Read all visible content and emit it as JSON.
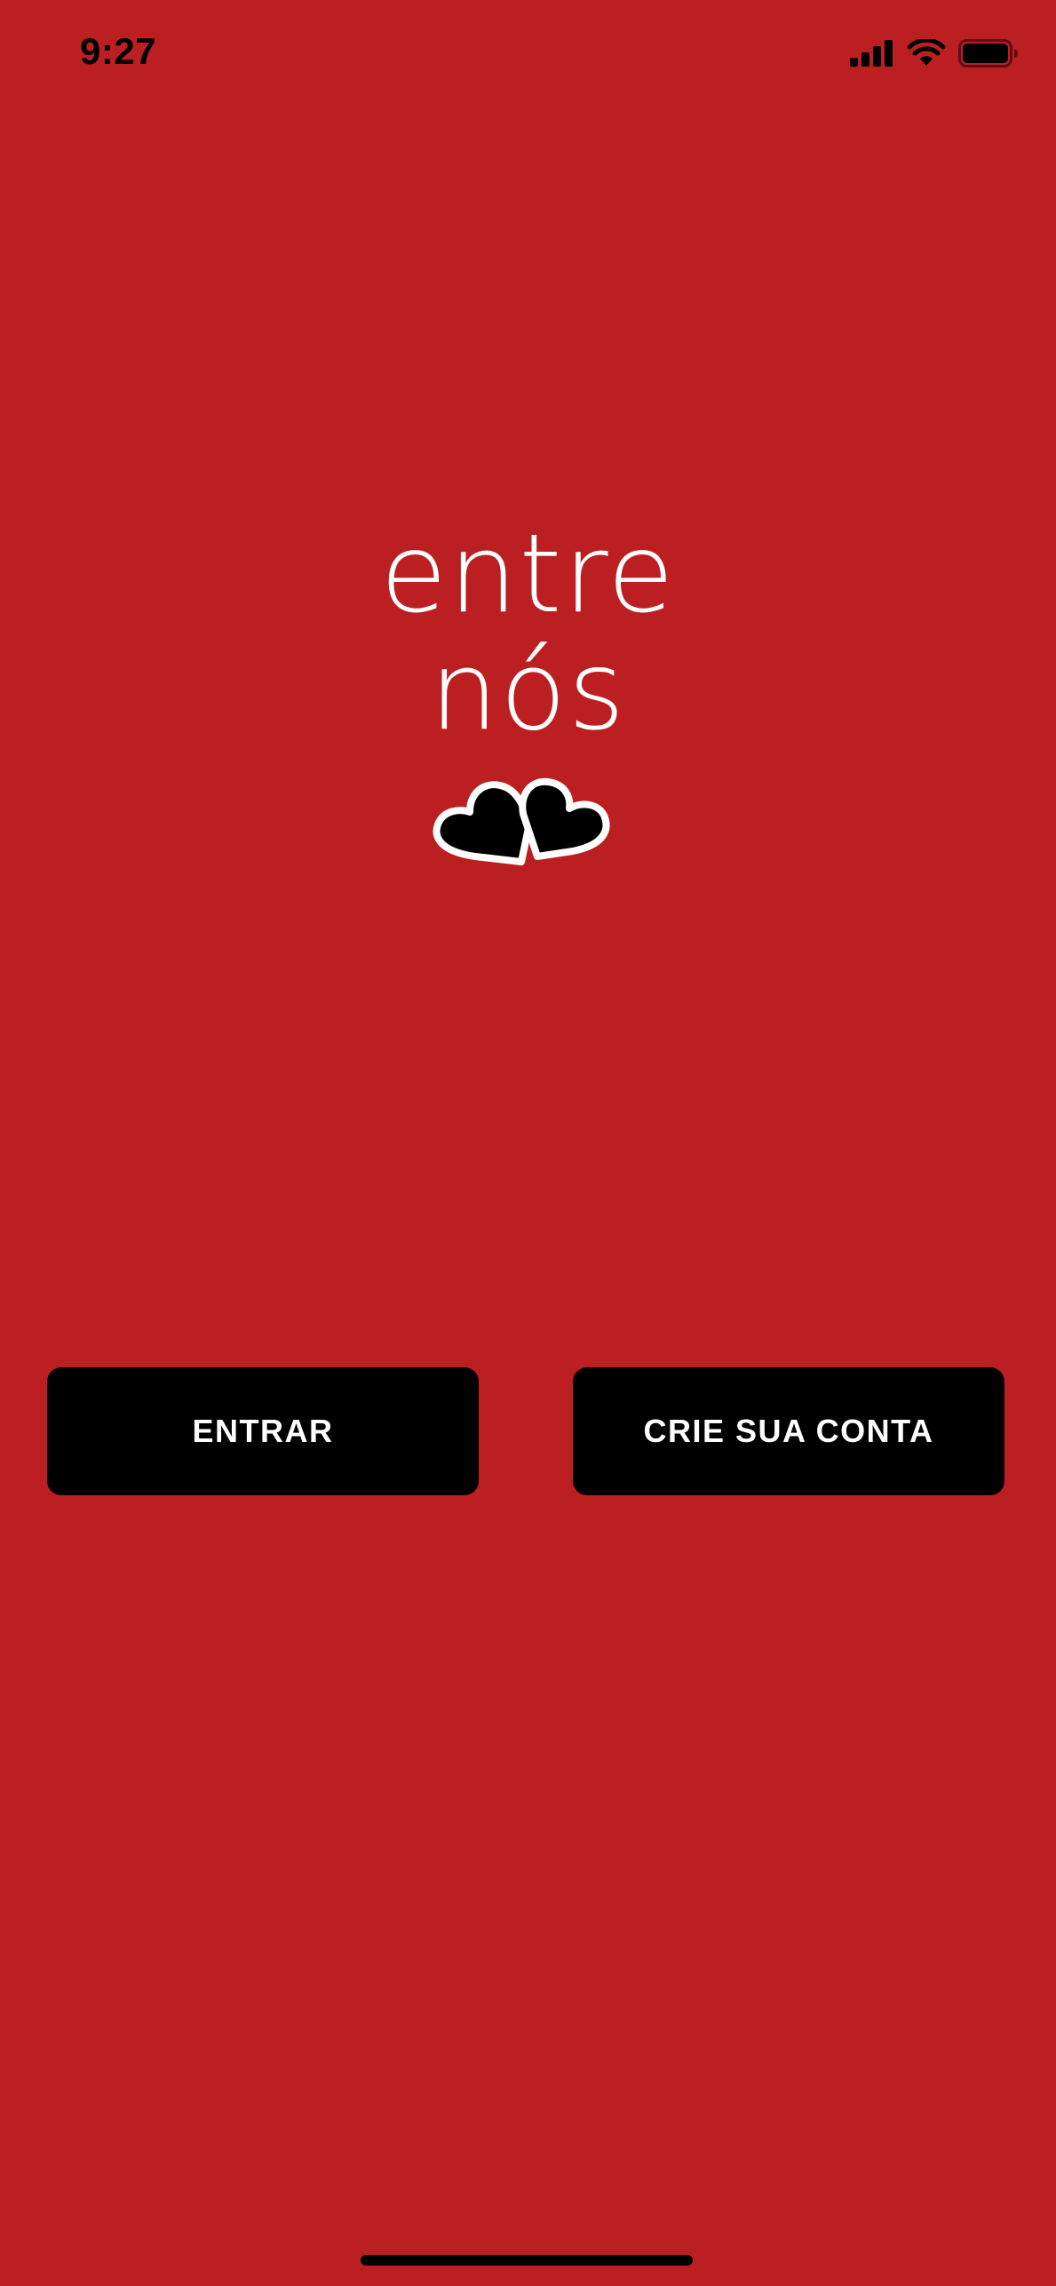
{
  "status_bar": {
    "time": "9:27",
    "icons": [
      "cellular-signal-icon",
      "wifi-icon",
      "battery-icon"
    ]
  },
  "logo": {
    "line1": "entre",
    "line2": "nós",
    "graphic": "two-hearts-icon"
  },
  "buttons": {
    "login_label": "ENTRAR",
    "signup_label": "CRIE SUA CONTA"
  },
  "colors": {
    "background": "#bc1f21",
    "button": "#000000",
    "text_light": "#ffffff"
  }
}
